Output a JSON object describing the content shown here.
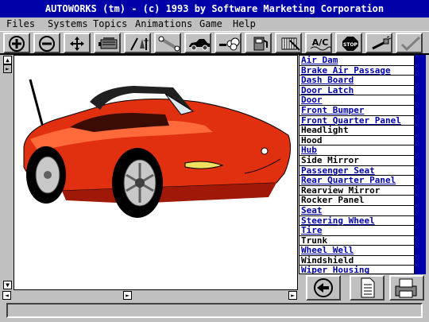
{
  "window": {
    "title": "AUTOWORKS (tm) - (c) 1993 by Software Marketing Corporation"
  },
  "menu": {
    "files": "Files",
    "systems": "Systems",
    "topics": "Topics",
    "animations": "Animations",
    "game": "Game",
    "help": "Help"
  },
  "toolbar": {
    "icons": [
      "zoom-in",
      "zoom-out",
      "move",
      "engine",
      "tools",
      "wrench",
      "car-side",
      "exhaust",
      "fuel-pump",
      "radiator",
      "air-conditioning",
      "stop",
      "spark-plug",
      "check"
    ],
    "ac_label": "A/C",
    "stop_label": "STOP"
  },
  "parts_list": {
    "items": [
      {
        "label": "Air Dam",
        "link": true
      },
      {
        "label": "Brake Air Passage",
        "link": true
      },
      {
        "label": "Dash Board",
        "link": true
      },
      {
        "label": "Door Latch",
        "link": true
      },
      {
        "label": "Door",
        "link": true
      },
      {
        "label": "Front Bumper",
        "link": true
      },
      {
        "label": "Front Quarter Panel",
        "link": true
      },
      {
        "label": "Headlight",
        "link": false
      },
      {
        "label": "Hood",
        "link": false
      },
      {
        "label": "Hub",
        "link": true
      },
      {
        "label": "Side Mirror",
        "link": false
      },
      {
        "label": "Passenger Seat",
        "link": true
      },
      {
        "label": "Rear Quarter Panel",
        "link": true
      },
      {
        "label": "Rearview Mirror",
        "link": false
      },
      {
        "label": "Rocker Panel",
        "link": false
      },
      {
        "label": "Seat",
        "link": true
      },
      {
        "label": "Steering Wheel",
        "link": true
      },
      {
        "label": "Tire",
        "link": true
      },
      {
        "label": "Trunk",
        "link": false
      },
      {
        "label": "Wheel Well",
        "link": true
      },
      {
        "label": "Windshield",
        "link": false
      },
      {
        "label": "Wiper Housing",
        "link": true
      }
    ]
  },
  "scroll": {
    "up": "▲",
    "down": "▼",
    "left": "◄",
    "right": "►"
  },
  "status": {
    "text": ""
  },
  "colors": {
    "car_body": "#e03010",
    "title_blue": "#0000a8",
    "face": "#c0c0c0"
  }
}
